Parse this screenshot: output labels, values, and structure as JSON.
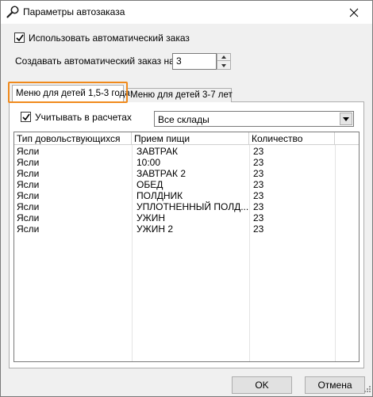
{
  "window": {
    "title": "Параметры автозаказа"
  },
  "auto_order": {
    "use_label": "Использовать автоматический заказ",
    "use_checked": true,
    "create_label": "Создавать автоматический заказ на:",
    "create_value": "3"
  },
  "tabs": [
    {
      "label": "Меню для детей 1,5-3 года",
      "active": true
    },
    {
      "label": "Меню для детей 3-7 лет",
      "active": false
    }
  ],
  "panel": {
    "account_label": "Учитывать в расчетах",
    "account_checked": true,
    "warehouse_value": "Все склады"
  },
  "table": {
    "columns": [
      "Тип довольствующихся",
      "Прием пищи",
      "Количество"
    ],
    "rows": [
      [
        "Ясли",
        "ЗАВТРАК",
        "23"
      ],
      [
        "Ясли",
        "10:00",
        "23"
      ],
      [
        "Ясли",
        "ЗАВТРАК 2",
        "23"
      ],
      [
        "Ясли",
        "ОБЕД",
        "23"
      ],
      [
        "Ясли",
        "ПОЛДНИК",
        "23"
      ],
      [
        "Ясли",
        "УПЛОТНЕННЫЙ ПОЛД...",
        "23"
      ],
      [
        "Ясли",
        "УЖИН",
        "23"
      ],
      [
        "Ясли",
        "УЖИН 2",
        "23"
      ]
    ]
  },
  "buttons": {
    "ok": "OK",
    "cancel": "Отмена"
  },
  "colors": {
    "highlight": "#f08a1c"
  }
}
